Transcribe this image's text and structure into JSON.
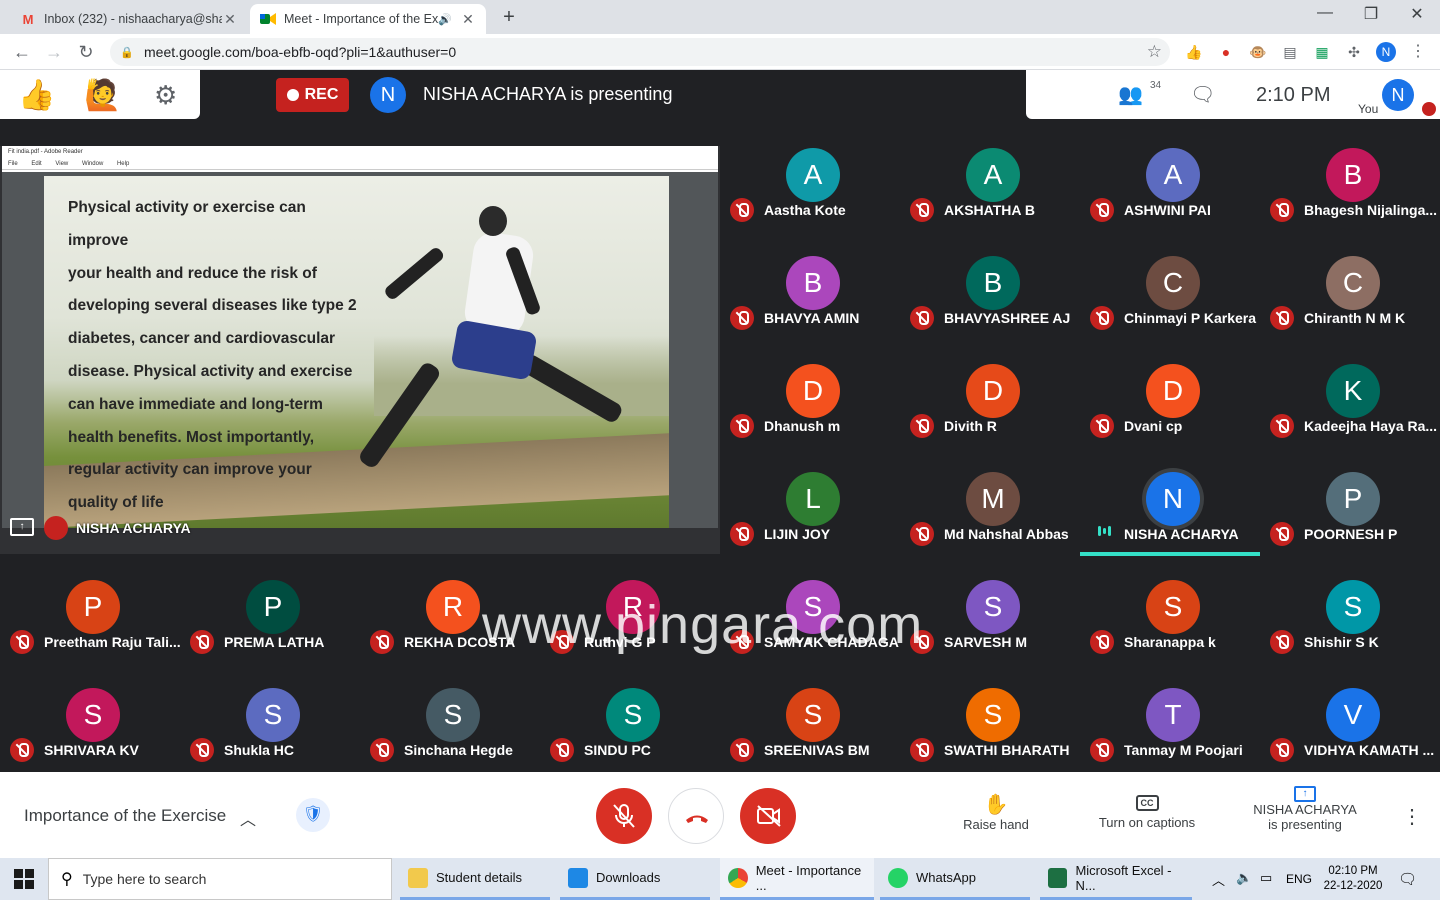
{
  "browser": {
    "tabs": [
      {
        "title": "Inbox (232) - nishaacharya@shak",
        "favicon": "gmail-icon",
        "active": false
      },
      {
        "title": "Meet - Importance of the Exe",
        "favicon": "meet-icon",
        "active": true
      }
    ],
    "url": "meet.google.com/boa-ebfb-oqd?pli=1&authuser=0",
    "profile_initial": "N"
  },
  "meet": {
    "rec_label": "REC",
    "presenter_initial": "N",
    "presenting_text": "NISHA ACHARYA is presenting",
    "participants_count": "34",
    "time": "2:10 PM",
    "you_label": "You",
    "self_initial": "N",
    "presentation": {
      "reader_title": "Fit india.pdf - Adobe Reader",
      "reader_menu": [
        "File",
        "Edit",
        "View",
        "Window",
        "Help"
      ],
      "slide_lines": [
        "Physical activity or exercise can improve",
        "your health and reduce the risk of",
        "developing several diseases like type 2",
        "diabetes, cancer and cardiovascular",
        "disease. Physical activity and exercise",
        "can have immediate and long-term",
        "health benefits. Most importantly,",
        "regular activity can improve your",
        "quality of life"
      ],
      "presenter_name": "NISHA ACHARYA"
    },
    "participants": [
      {
        "initial": "A",
        "name": "Aastha Kote",
        "color": "#0f9aa8"
      },
      {
        "initial": "A",
        "name": "AKSHATHA B",
        "color": "#0b8a72"
      },
      {
        "initial": "A",
        "name": "ASHWINI PAI",
        "color": "#5c6bc0"
      },
      {
        "initial": "B",
        "name": "Bhagesh Nijalinga...",
        "color": "#c2185b"
      },
      {
        "initial": "B",
        "name": "BHAVYA AMIN",
        "color": "#ab47bc"
      },
      {
        "initial": "B",
        "name": "BHAVYASHREE AJ",
        "color": "#00695c"
      },
      {
        "initial": "C",
        "name": "Chinmayi P Karkera",
        "color": "#6d4c41"
      },
      {
        "initial": "C",
        "name": "Chiranth N M K",
        "color": "#8d6e63"
      },
      {
        "initial": "D",
        "name": "Dhanush m",
        "color": "#f4511e"
      },
      {
        "initial": "D",
        "name": "Divith R",
        "color": "#e64a19"
      },
      {
        "initial": "D",
        "name": "Dvani cp",
        "color": "#f4511e"
      },
      {
        "initial": "K",
        "name": "Kadeejha Haya Ra...",
        "color": "#00695c"
      },
      {
        "initial": "L",
        "name": "LIJIN JOY",
        "color": "#2e7d32"
      },
      {
        "initial": "M",
        "name": "Md Nahshal Abbas",
        "color": "#6d4c41"
      },
      {
        "initial": "N",
        "name": "NISHA ACHARYA",
        "color": "#1a73e8",
        "speaking": true
      },
      {
        "initial": "P",
        "name": "POORNESH P",
        "color": "#546e7a"
      },
      {
        "initial": "P",
        "name": "Preetham Raju Tali...",
        "color": "#d84315"
      },
      {
        "initial": "P",
        "name": "PREMA LATHA",
        "color": "#004d40"
      },
      {
        "initial": "R",
        "name": "REKHA DCOSTA",
        "color": "#f4511e"
      },
      {
        "initial": "R",
        "name": "Ruthvi G P",
        "color": "#c2185b"
      },
      {
        "initial": "S",
        "name": "SAMYAK CHADAGA",
        "color": "#ab47bc"
      },
      {
        "initial": "S",
        "name": "SARVESH M",
        "color": "#7e57c2"
      },
      {
        "initial": "S",
        "name": "Sharanappa k",
        "color": "#d84315"
      },
      {
        "initial": "S",
        "name": "Shishir S K",
        "color": "#0097a7"
      },
      {
        "initial": "S",
        "name": "SHRIVARA KV",
        "color": "#c2185b"
      },
      {
        "initial": "S",
        "name": "Shukla HC",
        "color": "#5c6bc0"
      },
      {
        "initial": "S",
        "name": "Sinchana Hegde",
        "color": "#455a64"
      },
      {
        "initial": "S",
        "name": "SINDU PC",
        "color": "#00897b"
      },
      {
        "initial": "S",
        "name": "SREENIVAS BM",
        "color": "#d84315"
      },
      {
        "initial": "S",
        "name": "SWATHI BHARATH",
        "color": "#ef6c00"
      },
      {
        "initial": "T",
        "name": "Tanmay M Poojari",
        "color": "#7e57c2"
      },
      {
        "initial": "V",
        "name": "VIDHYA KAMATH ...",
        "color": "#1a73e8"
      }
    ],
    "watermark": "www.pingara.com",
    "bottom": {
      "meeting_title": "Importance of the Exercise",
      "raise_hand": "Raise hand",
      "captions": "Turn on captions",
      "presenting_name": "NISHA ACHARYA",
      "presenting_sub": "is presenting"
    }
  },
  "taskbar": {
    "search_placeholder": "Type here to search",
    "items": [
      {
        "label": "Student details",
        "icon": "folder-icon",
        "color": "#f2c94c"
      },
      {
        "label": "Downloads",
        "icon": "download-icon",
        "color": "#1e88e5"
      },
      {
        "label": "Meet - Importance ...",
        "icon": "chrome-icon",
        "color": "#34a853"
      },
      {
        "label": "WhatsApp",
        "icon": "whatsapp-icon",
        "color": "#25d366"
      },
      {
        "label": "Microsoft Excel - N...",
        "icon": "excel-icon",
        "color": "#1d6f42"
      }
    ],
    "lang": "ENG",
    "clock_time": "02:10 PM",
    "clock_date": "22-12-2020"
  }
}
